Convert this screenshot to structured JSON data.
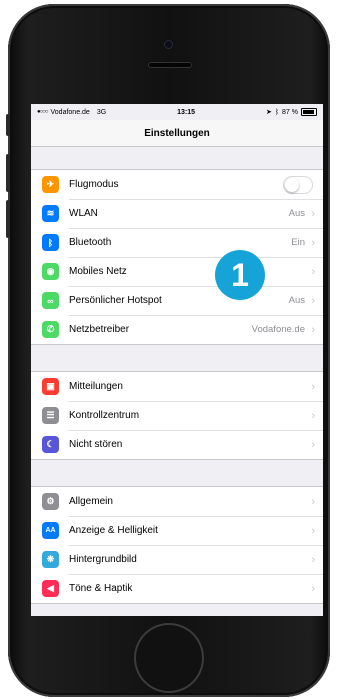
{
  "status_bar": {
    "carrier_dots": "●○○○",
    "carrier": "Vodafone.de",
    "network": "3G",
    "time": "13:15",
    "battery": "87 %"
  },
  "nav": {
    "title": "Einstellungen"
  },
  "groups": [
    {
      "rows": [
        {
          "label": "Flugmodus",
          "value": "",
          "icon": "airplane-icon",
          "color": "#ff9500"
        },
        {
          "label": "WLAN",
          "value": "Aus",
          "icon": "wifi-icon",
          "color": "#007aff"
        },
        {
          "label": "Bluetooth",
          "value": "Ein",
          "icon": "bluetooth-icon",
          "color": "#007aff"
        },
        {
          "label": "Mobiles Netz",
          "value": "",
          "icon": "antenna-icon",
          "color": "#4cd964"
        },
        {
          "label": "Persönlicher Hotspot",
          "value": "Aus",
          "icon": "hotspot-icon",
          "color": "#4cd964"
        },
        {
          "label": "Netzbetreiber",
          "value": "Vodafone.de",
          "icon": "phone-icon",
          "color": "#4cd964"
        }
      ]
    },
    {
      "rows": [
        {
          "label": "Mitteilungen",
          "value": "",
          "icon": "notifications-icon",
          "color": "#ff3b30"
        },
        {
          "label": "Kontrollzentrum",
          "value": "",
          "icon": "control-center-icon",
          "color": "#8e8e93"
        },
        {
          "label": "Nicht stören",
          "value": "",
          "icon": "moon-icon",
          "color": "#5856d6"
        }
      ]
    },
    {
      "rows": [
        {
          "label": "Allgemein",
          "value": "",
          "icon": "gear-icon",
          "color": "#8e8e93"
        },
        {
          "label": "Anzeige & Helligkeit",
          "value": "",
          "icon": "display-icon",
          "color": "#007aff"
        },
        {
          "label": "Hintergrundbild",
          "value": "",
          "icon": "wallpaper-icon",
          "color": "#34aadc"
        },
        {
          "label": "Töne & Haptik",
          "value": "",
          "icon": "sound-icon",
          "color": "#ff2d55"
        }
      ]
    }
  ],
  "airplane_mode_on": false,
  "badge": {
    "number": "1",
    "color": "#16a4d8"
  }
}
